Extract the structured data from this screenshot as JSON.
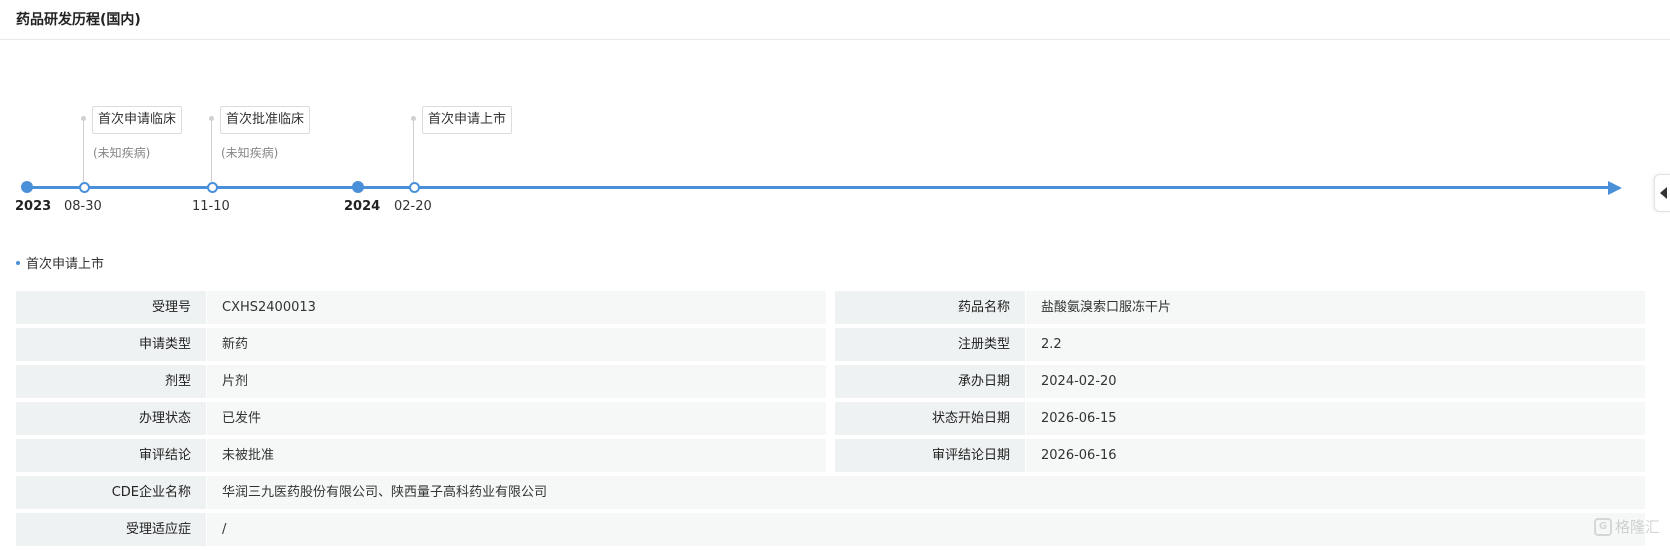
{
  "header": {
    "title": "药品研发历程(国内)"
  },
  "timeline": {
    "years": [
      "2023",
      "2024"
    ],
    "events": [
      {
        "date": "08-30",
        "title": "首次申请临床",
        "sub": "(未知疾病)"
      },
      {
        "date": "11-10",
        "title": "首次批准临床",
        "sub": "(未知疾病)"
      },
      {
        "date": "02-20",
        "title": "首次申请上市",
        "sub": ""
      }
    ]
  },
  "section": {
    "title": "首次申请上市"
  },
  "info": {
    "rows": [
      [
        {
          "label": "受理号",
          "value": "CXHS2400013"
        },
        {
          "label": "药品名称",
          "value": "盐酸氨溴索口服冻干片"
        }
      ],
      [
        {
          "label": "申请类型",
          "value": "新药"
        },
        {
          "label": "注册类型",
          "value": "2.2"
        }
      ],
      [
        {
          "label": "剂型",
          "value": "片剂"
        },
        {
          "label": "承办日期",
          "value": "2024-02-20"
        }
      ],
      [
        {
          "label": "办理状态",
          "value": "已发件"
        },
        {
          "label": "状态开始日期",
          "value": "2026-06-15"
        }
      ],
      [
        {
          "label": "审评结论",
          "value": "未被批准"
        },
        {
          "label": "审评结论日期",
          "value": "2026-06-16"
        }
      ]
    ],
    "full_rows": [
      {
        "label": "CDE企业名称",
        "value": "华润三九医药股份有限公司、陕西量子高科药业有限公司"
      },
      {
        "label": "受理适应症",
        "value": "/"
      }
    ]
  },
  "watermark": {
    "text": "格隆汇"
  },
  "colors": {
    "accent": "#4a90d9"
  }
}
